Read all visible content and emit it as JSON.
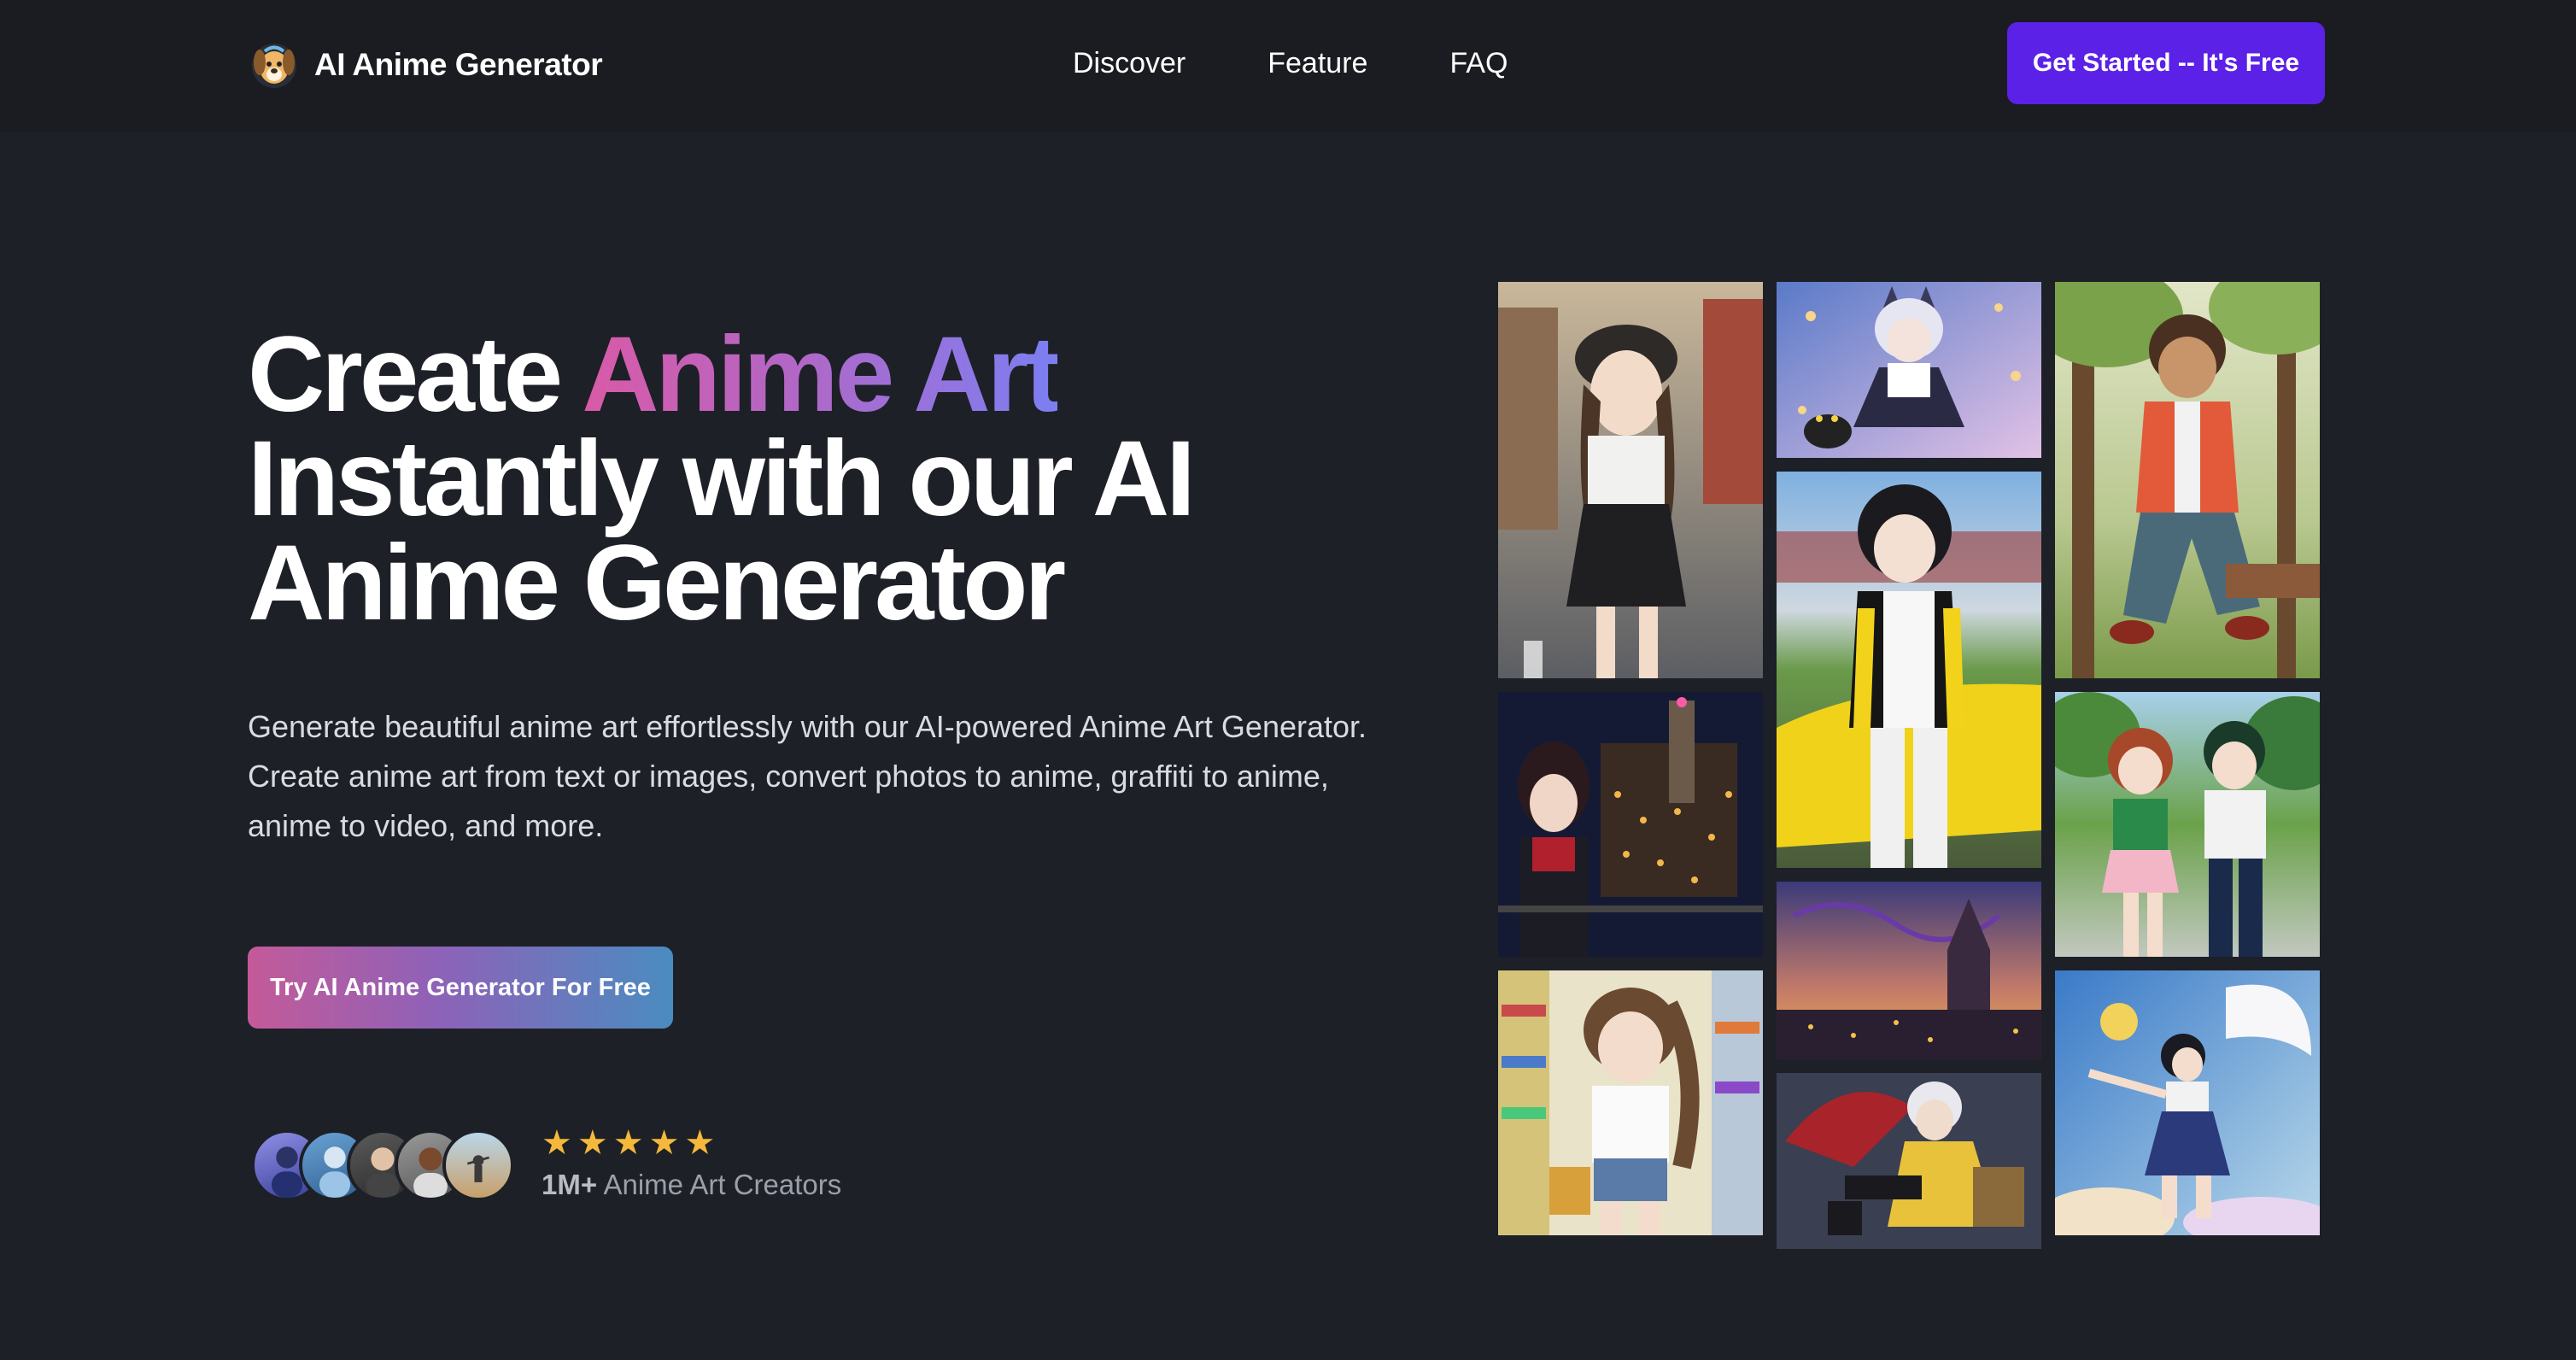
{
  "header": {
    "logo_text": "AI Anime Generator",
    "nav": [
      "Discover",
      "Feature",
      "FAQ"
    ],
    "cta_label": "Get Started -- It's Free"
  },
  "hero": {
    "title_line1_plain": "Create",
    "title_line1_gradient": "Anime Art",
    "title_line2": "Instantly with our AI",
    "title_line3": "Anime Generator",
    "description": "Generate beautiful anime art effortlessly with our AI-powered Anime Art Generator. Create anime art from text or images, convert photos to anime, graffiti to anime, anime to video, and more.",
    "cta_label": "Try AI Anime Generator For Free"
  },
  "social_proof": {
    "rating": 5,
    "count": "1M+",
    "label": "Anime Art Creators"
  },
  "colors": {
    "background": "#1d2027",
    "header_bg": "#1a1c21",
    "accent": "#5b21e6",
    "star": "#f5b83a"
  }
}
